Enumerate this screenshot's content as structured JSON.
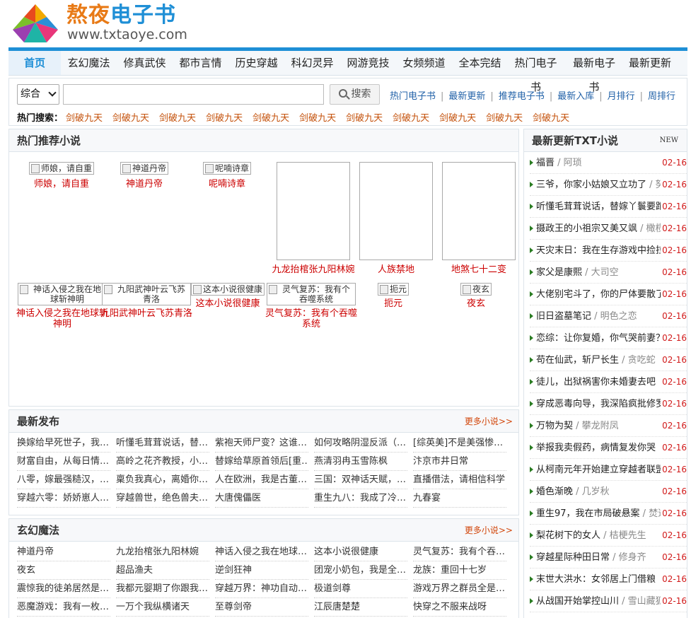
{
  "site": {
    "name_part1": "熬夜",
    "name_part2": "电子书",
    "url": "www.txtaoye.com"
  },
  "nav": [
    "首页",
    "玄幻魔法",
    "修真武侠",
    "都市言情",
    "历史穿越",
    "科幻灵异",
    "网游竞技",
    "女频频道",
    "全本完结",
    "热门电子书",
    "最新电子书",
    "最新更新"
  ],
  "search": {
    "select_value": "综合",
    "button_label": "搜索",
    "quick_links": [
      "热门电子书",
      "最新更新",
      "推荐电子书",
      "最新入库",
      "月排行",
      "周排行"
    ],
    "hot_label": "热门搜索：",
    "hot_items": [
      "剑破九天",
      "剑破九天",
      "剑破九天",
      "剑破九天",
      "剑破九天",
      "剑破九天",
      "剑破九天",
      "剑破九天",
      "剑破九天",
      "剑破九天",
      "剑破九天"
    ]
  },
  "hot_recommend": {
    "title": "热门推荐小说",
    "row1": [
      {
        "alt": "师娘，请自重",
        "title": "师娘，请自重"
      },
      {
        "alt": "神道丹帝",
        "title": "神道丹帝"
      },
      {
        "alt": "呢喃诗章",
        "title": "呢喃诗章"
      },
      {
        "alt": "",
        "title": "九龙抬棺张九阳林婉"
      },
      {
        "alt": "",
        "title": "人族禁地"
      },
      {
        "alt": "",
        "title": "地煞七十二变"
      }
    ],
    "row2": [
      {
        "alt": "神话入侵之我在地球斩神明",
        "title": "神话入侵之我在地球斩神明"
      },
      {
        "alt": "九阳武神叶云飞苏青洛",
        "title": "九阳武神叶云飞苏青洛"
      },
      {
        "alt": "这本小说很健康",
        "title": "这本小说很健康"
      },
      {
        "alt": "灵气复苏：我有个吞噬系统",
        "title": "灵气复苏：我有个吞噬系统"
      },
      {
        "alt": "扼元",
        "title": "扼元"
      },
      {
        "alt": "夜玄",
        "title": "夜玄"
      }
    ]
  },
  "latest_release": {
    "title": "最新发布",
    "more": "更多小说>>",
    "rows": [
      [
        "换嫁给早死世子，我…",
        "听懂毛茸茸说话，替…",
        "紫袍天师尸变？这谁…",
        "如何攻略阴湿反派（…",
        "[综英美]不是美强惨…"
      ],
      [
        "财富自由，从每日情…",
        "高岭之花齐教授，小…",
        "替嫁给草原首领后[重…",
        "燕清羽冉玉雪陈枫",
        "汴京市井日常"
      ],
      [
        "八零，嫁最强糙汉，…",
        "稟负我真心，离婚你…",
        "人在欧洲，我是古董…",
        "三国：双神话天赋，…",
        "直播借法，请相信科学"
      ],
      [
        "穿越六零：娇娇崽人…",
        "穿越兽世，绝色兽夫…",
        "大唐傀儡医",
        "重生九八：我成了冷…",
        "九春宴"
      ]
    ]
  },
  "xuanhuan": {
    "title": "玄幻魔法",
    "more": "更多小说>>",
    "rows": [
      [
        "神道丹帝",
        "九龙抬棺张九阳林婉",
        "神话入侵之我在地球…",
        "这本小说很健康",
        "灵气复苏：我有个吞…"
      ],
      [
        "夜玄",
        "超品渔夫",
        "逆剑狂神",
        "团宠小奶包，我是全…",
        "龙族：重回十七岁"
      ],
      [
        "震惊我的徒弟居然是…",
        "我都元婴期了你跟我…",
        "穿越万界：神功自动…",
        "极道剑尊",
        "游戏万界之群员全是…"
      ],
      [
        "恶魔游戏：我有一枚…",
        "一万个我纵横诸天",
        "至尊剑帝",
        "江辰唐楚楚",
        "快穿之不服来战呀"
      ]
    ]
  },
  "latest_update": {
    "title": "最新更新TXT小说",
    "badge": "NEW",
    "items": [
      {
        "title": "福晋",
        "author": "阿琐",
        "date": "02-16"
      },
      {
        "title": "三爷，你家小姑娘又立功了",
        "author": "努",
        "date": "02-16"
      },
      {
        "title": "听懂毛茸茸说话，替嫁丫鬟要跑",
        "author": "",
        "date": "02-16"
      },
      {
        "title": "摄政王的小祖宗又美又飒",
        "author": "橄榄",
        "date": "02-16"
      },
      {
        "title": "天灾末日：我在生存游戏中捡拉",
        "author": "",
        "date": "02-16"
      },
      {
        "title": "家父是康熙",
        "author": "大司空",
        "date": "02-16"
      },
      {
        "title": "大佬别宅斗了，你的尸体要散了",
        "author": "",
        "date": "02-16"
      },
      {
        "title": "旧日盗墓笔记",
        "author": "明色之恋",
        "date": "02-16"
      },
      {
        "title": "恋综：让你复婚，你气哭前妻？",
        "author": "",
        "date": "02-16"
      },
      {
        "title": "苟在仙武，斩尸长生",
        "author": "贪吃蛇",
        "date": "02-16"
      },
      {
        "title": "徒儿，出狱祸害你未婚妻去吧",
        "author": "",
        "date": "02-16"
      },
      {
        "title": "穿成恶毒向导，我深陷疯批修罗",
        "author": "",
        "date": "02-16"
      },
      {
        "title": "万物为契",
        "author": "攀龙附凤",
        "date": "02-16"
      },
      {
        "title": "举报我卖假药，病情复发你哭",
        "author": "",
        "date": "02-16"
      },
      {
        "title": "从柯南元年开始建立穿越者联盟",
        "author": "",
        "date": "02-16"
      },
      {
        "title": "婚色渐晚",
        "author": "几岁秋",
        "date": "02-16"
      },
      {
        "title": "重生97，我在市局破悬案",
        "author": "焚道",
        "date": "02-16"
      },
      {
        "title": "梨花树下的女人",
        "author": "桔梗先生",
        "date": "02-16"
      },
      {
        "title": "穿越星际种田日常",
        "author": "修身齐",
        "date": "02-16"
      },
      {
        "title": "末世大洪水：女邻居上门借粮",
        "author": "",
        "date": "02-16"
      },
      {
        "title": "从战国开始掌控山川",
        "author": "雪山藏狐",
        "date": "02-16"
      }
    ]
  },
  "colors": {
    "accent_blue": "#1e8fd6",
    "logo_orange": "#e87a16",
    "title_red": "#cc0000",
    "date_red": "#d11a1a",
    "more_orange": "#d2460a"
  }
}
